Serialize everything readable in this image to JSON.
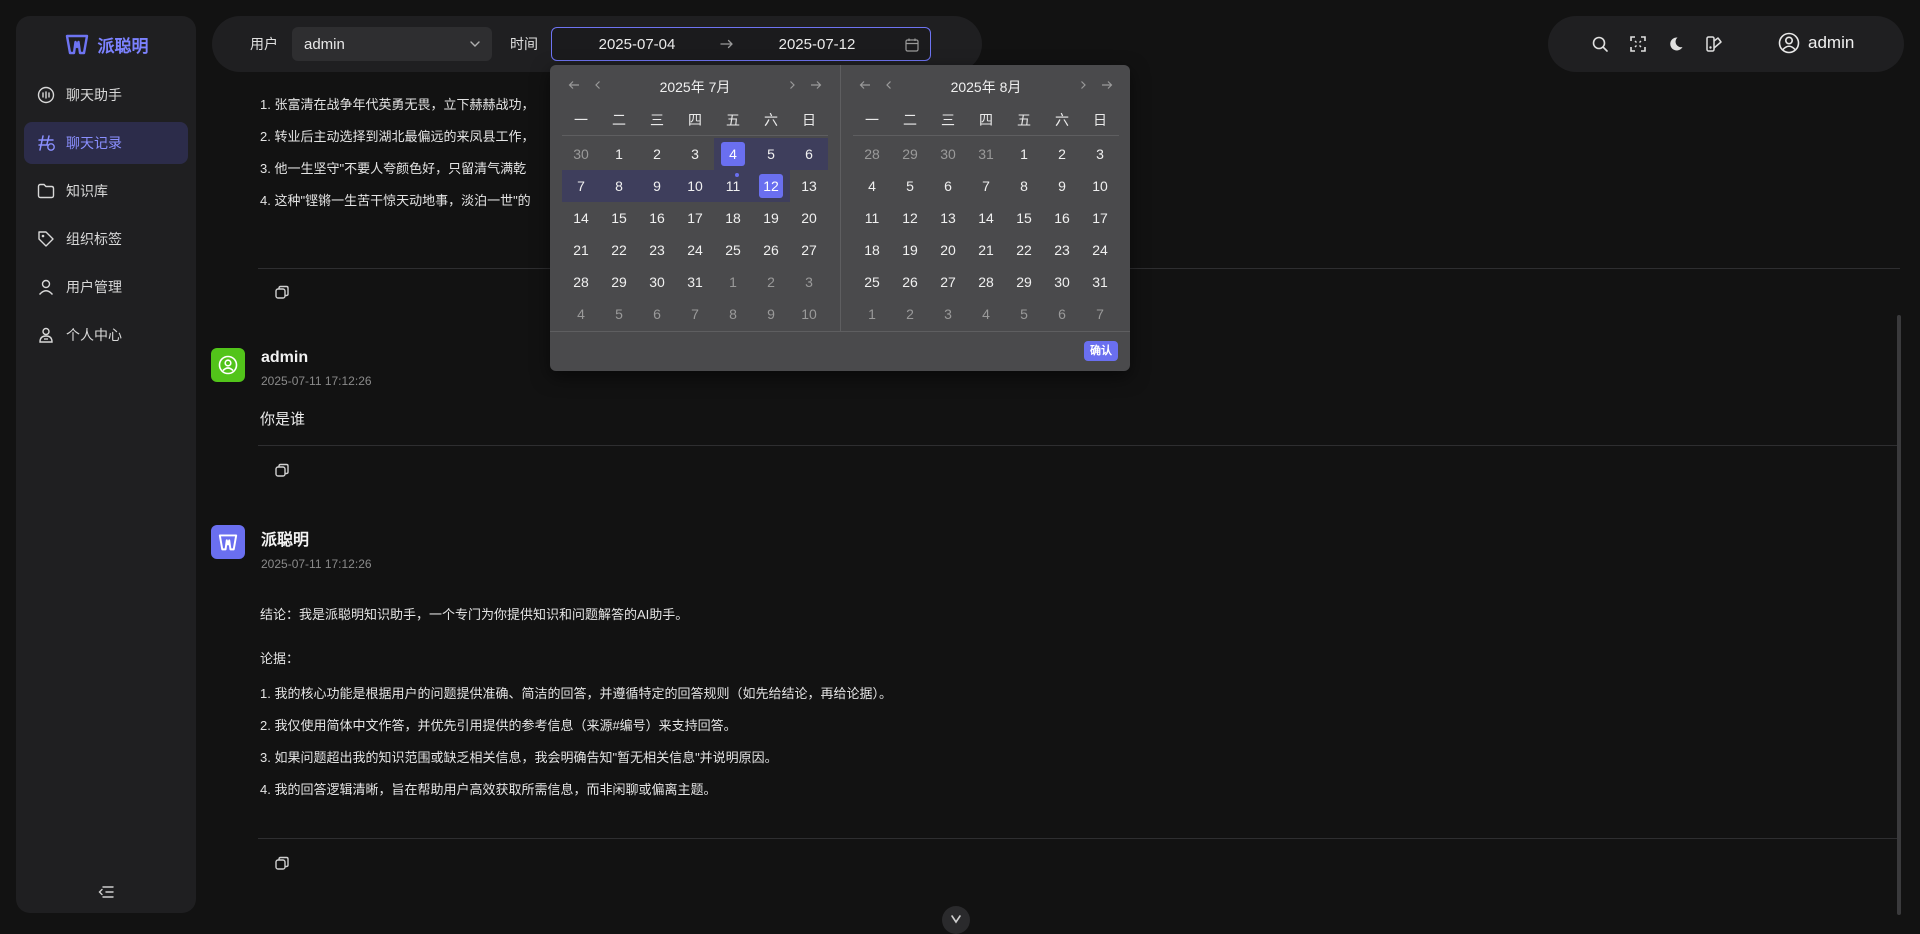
{
  "app": {
    "name": "派聪明",
    "accent": "#6a6ff0"
  },
  "sidebar": {
    "items": [
      {
        "label": "聊天助手",
        "icon": "chat-bubble-icon"
      },
      {
        "label": "聊天记录",
        "icon": "history-icon",
        "active": true
      },
      {
        "label": "知识库",
        "icon": "folder-icon"
      },
      {
        "label": "组织标签",
        "icon": "tag-icon"
      },
      {
        "label": "用户管理",
        "icon": "user-icon"
      },
      {
        "label": "个人中心",
        "icon": "personal-center-icon"
      }
    ],
    "collapse_icon": "collapse-menu-icon"
  },
  "filter": {
    "user_label": "用户",
    "user_value": "admin",
    "time_label": "时间",
    "start_date": "2025-07-04",
    "end_date": "2025-07-12"
  },
  "header": {
    "username": "admin"
  },
  "picker": {
    "weekdays": [
      "一",
      "二",
      "三",
      "四",
      "五",
      "六",
      "日"
    ],
    "confirm_label": "确认",
    "months": [
      {
        "title": "2025年 7月",
        "weeks": [
          [
            [
              "30",
              "muted"
            ],
            [
              "1",
              ""
            ],
            [
              "2",
              ""
            ],
            [
              "3",
              ""
            ],
            [
              "4",
              "sel inrange"
            ],
            [
              "5",
              "inrange"
            ],
            [
              "6",
              "inrange"
            ]
          ],
          [
            [
              "7",
              "inrange"
            ],
            [
              "8",
              "inrange"
            ],
            [
              "9",
              "inrange"
            ],
            [
              "10",
              "inrange"
            ],
            [
              "11",
              "inrange today"
            ],
            [
              "12",
              "sel inrange"
            ],
            [
              "13",
              ""
            ]
          ],
          [
            [
              "14",
              ""
            ],
            [
              "15",
              ""
            ],
            [
              "16",
              ""
            ],
            [
              "17",
              ""
            ],
            [
              "18",
              ""
            ],
            [
              "19",
              ""
            ],
            [
              "20",
              ""
            ]
          ],
          [
            [
              "21",
              ""
            ],
            [
              "22",
              ""
            ],
            [
              "23",
              ""
            ],
            [
              "24",
              ""
            ],
            [
              "25",
              ""
            ],
            [
              "26",
              ""
            ],
            [
              "27",
              ""
            ]
          ],
          [
            [
              "28",
              ""
            ],
            [
              "29",
              ""
            ],
            [
              "30",
              ""
            ],
            [
              "31",
              ""
            ],
            [
              "1",
              "muted"
            ],
            [
              "2",
              "muted"
            ],
            [
              "3",
              "muted"
            ]
          ],
          [
            [
              "4",
              "muted"
            ],
            [
              "5",
              "muted"
            ],
            [
              "6",
              "muted"
            ],
            [
              "7",
              "muted"
            ],
            [
              "8",
              "muted"
            ],
            [
              "9",
              "muted"
            ],
            [
              "10",
              "muted"
            ]
          ]
        ]
      },
      {
        "title": "2025年 8月",
        "weeks": [
          [
            [
              "28",
              "muted"
            ],
            [
              "29",
              "muted"
            ],
            [
              "30",
              "muted"
            ],
            [
              "31",
              "muted"
            ],
            [
              "1",
              ""
            ],
            [
              "2",
              ""
            ],
            [
              "3",
              ""
            ]
          ],
          [
            [
              "4",
              ""
            ],
            [
              "5",
              ""
            ],
            [
              "6",
              ""
            ],
            [
              "7",
              ""
            ],
            [
              "8",
              ""
            ],
            [
              "9",
              ""
            ],
            [
              "10",
              ""
            ]
          ],
          [
            [
              "11",
              ""
            ],
            [
              "12",
              ""
            ],
            [
              "13",
              ""
            ],
            [
              "14",
              ""
            ],
            [
              "15",
              ""
            ],
            [
              "16",
              ""
            ],
            [
              "17",
              ""
            ]
          ],
          [
            [
              "18",
              ""
            ],
            [
              "19",
              ""
            ],
            [
              "20",
              ""
            ],
            [
              "21",
              ""
            ],
            [
              "22",
              ""
            ],
            [
              "23",
              ""
            ],
            [
              "24",
              ""
            ]
          ],
          [
            [
              "25",
              ""
            ],
            [
              "26",
              ""
            ],
            [
              "27",
              ""
            ],
            [
              "28",
              ""
            ],
            [
              "29",
              ""
            ],
            [
              "30",
              ""
            ],
            [
              "31",
              ""
            ]
          ],
          [
            [
              "1",
              "muted"
            ],
            [
              "2",
              "muted"
            ],
            [
              "3",
              "muted"
            ],
            [
              "4",
              "muted"
            ],
            [
              "5",
              "muted"
            ],
            [
              "6",
              "muted"
            ],
            [
              "7",
              "muted"
            ]
          ]
        ]
      }
    ]
  },
  "chat": {
    "prev_answer_items": [
      "1. 张富清在战争年代英勇无畏，立下赫赫战功，",
      "2. 转业后主动选择到湖北最偏远的来凤县工作，",
      "3. 他一生坚守\"不要人夸颜色好，只留清气满乾",
      "4. 这种\"铿锵一生苦干惊天动地事，淡泊一世\"的"
    ],
    "user_msg": {
      "name": "admin",
      "time": "2025-07-11 17:12:26",
      "text": "你是谁",
      "avatar_color": "#52c41a"
    },
    "bot_msg": {
      "name": "派聪明",
      "time": "2025-07-11 17:12:26",
      "avatar_color": "#6a6ff0",
      "conclusion": "结论：我是派聪明知识助手，一个专门为你提供知识和问题解答的AI助手。",
      "evidence_label": "论据：",
      "items": [
        "1. 我的核心功能是根据用户的问题提供准确、简洁的回答，并遵循特定的回答规则（如先给结论，再给论据）。",
        "2. 我仅使用简体中文作答，并优先引用提供的参考信息（来源#编号）来支持回答。",
        "3. 如果问题超出我的知识范围或缺乏相关信息，我会明确告知\"暂无相关信息\"并说明原因。",
        "4. 我的回答逻辑清晰，旨在帮助用户高效获取所需信息，而非闲聊或偏离主题。"
      ]
    }
  }
}
